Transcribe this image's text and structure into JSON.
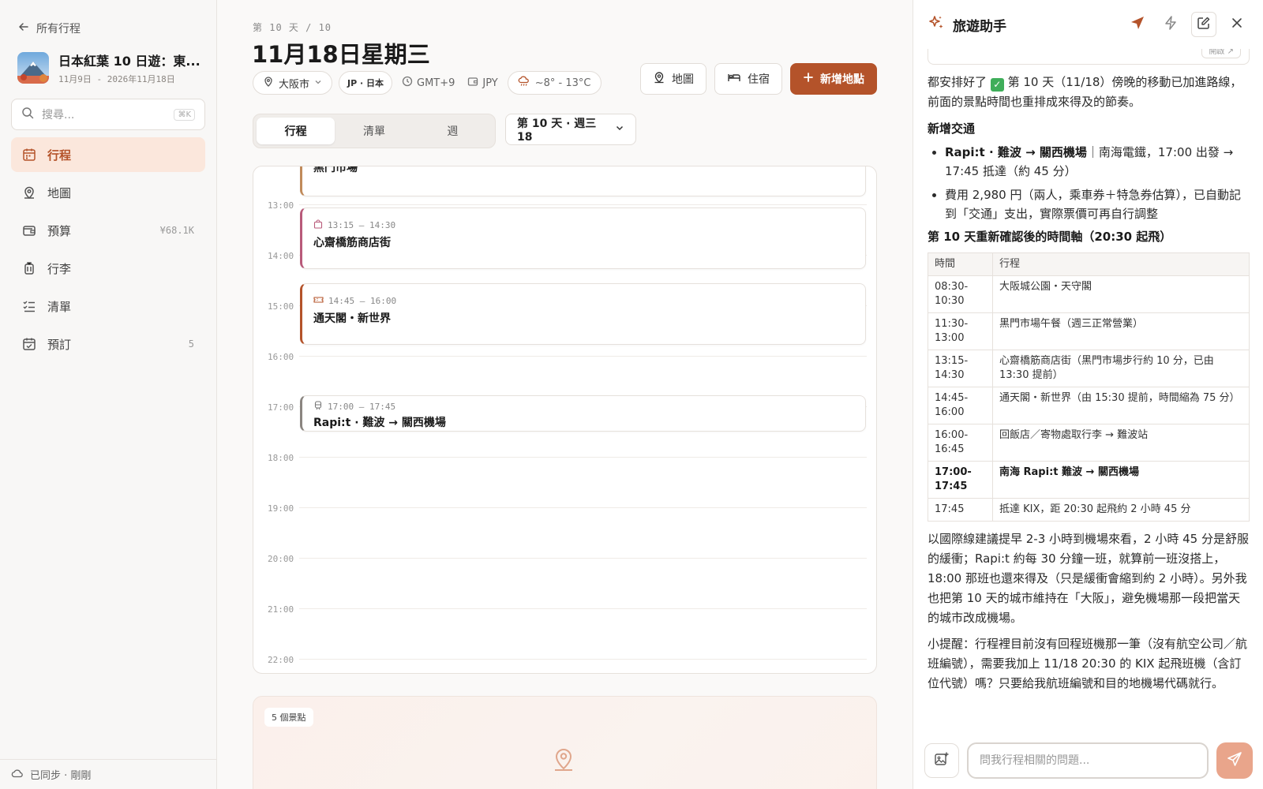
{
  "sidebar": {
    "back_label": "所有行程",
    "trip": {
      "title": "日本紅葉 10 日遊：東...",
      "dates": "11月9日 - 2026年11月18日"
    },
    "search": {
      "placeholder": "搜尋...",
      "shortcut": "⌘K"
    },
    "items": [
      {
        "label": "行程",
        "icon": "calendar-icon",
        "badge": "",
        "active": true
      },
      {
        "label": "地圖",
        "icon": "map-pin-icon",
        "badge": "",
        "active": false
      },
      {
        "label": "預算",
        "icon": "wallet-icon",
        "badge": "¥68.1K",
        "active": false
      },
      {
        "label": "行李",
        "icon": "luggage-icon",
        "badge": "",
        "active": false
      },
      {
        "label": "清單",
        "icon": "checklist-icon",
        "badge": "",
        "active": false
      },
      {
        "label": "預訂",
        "icon": "booking-calendar-icon",
        "badge": "5",
        "active": false
      }
    ],
    "sync_status": "已同步 · 剛剛"
  },
  "main": {
    "day_counter": "第 10 天 / 10",
    "day_title": "11月18日星期三",
    "meta": {
      "city": "大阪市",
      "country": "JP · 日本",
      "timezone": "GMT+9",
      "currency": "JPY",
      "weather": "~8° - 13°C"
    },
    "actions": {
      "map": "地圖",
      "lodging": "住宿",
      "add_place": "新增地點"
    },
    "view_tabs": [
      "行程",
      "清單",
      "週"
    ],
    "day_select": "第 10 天 · 週三 18",
    "hours": [
      "13:00",
      "14:00",
      "15:00",
      "16:00",
      "17:00",
      "18:00",
      "19:00",
      "20:00",
      "21:00",
      "22:00"
    ],
    "events": {
      "partial": {
        "title": "黑門市場"
      },
      "shotengai": {
        "time": "13:15 – 14:30",
        "title": "心齋橋筋商店街"
      },
      "tsutenkaku": {
        "time": "14:45 – 16:00",
        "title": "通天閣・新世界"
      },
      "rapit": {
        "time": "17:00 – 17:45",
        "title": "Rapi:t · 難波 → 關西機場"
      }
    },
    "places_badge": "5 個景點"
  },
  "assistant": {
    "title": "旅遊助手",
    "prev_chip": "開啟",
    "intro": "都安排好了 ✅ 第 10 天（11/18）傍晚的移動已加進路線，前面的景點時間也重排成來得及的節奏。",
    "intro_before": "都安排好了",
    "intro_after": "第 10 天（11/18）傍晚的移動已加進路線，前面的景點時間也重排成來得及的節奏。",
    "transport_heading": "新增交通",
    "bullet1_bold": "Rapi:t · 難波 → 關西機場",
    "bullet1_rest": "｜南海電鐵，17:00 出發 → 17:45 抵達（約 45 分）",
    "bullet2": "費用 2,980 円（兩人，乘車券＋特急券估算），已自動記到「交通」支出，實際票價可再自行調整",
    "timeline_heading": "第 10 天重新確認後的時間軸（20:30 起飛）",
    "table": {
      "headers": [
        "時間",
        "行程"
      ],
      "rows": [
        {
          "time": "08:30-10:30",
          "item": "大阪城公園・天守閣",
          "bold": false
        },
        {
          "time": "11:30-13:00",
          "item": "黑門市場午餐（週三正常營業）",
          "bold": false
        },
        {
          "time": "13:15-14:30",
          "item": "心齋橋筋商店街（黑門市場步行約 10 分，已由 13:30 提前）",
          "bold": false
        },
        {
          "time": "14:45-16:00",
          "item": "通天閣・新世界（由 15:30 提前，時間縮為 75 分）",
          "bold": false
        },
        {
          "time": "16:00-16:45",
          "item": "回飯店／寄物處取行李 → 難波站",
          "bold": false
        },
        {
          "time": "17:00-17:45",
          "item": "南海 Rapi:t 難波 → 關西機場",
          "bold": true
        },
        {
          "time": "17:45",
          "item": "抵達 KIX，距 20:30 起飛約 2 小時 45 分",
          "bold": false
        }
      ]
    },
    "para_buffer": "以國際線建議提早 2-3 小時到機場來看，2 小時 45 分是舒服的緩衝；Rapi:t 約每 30 分鐘一班，就算前一班沒搭上，18:00 那班也還來得及（只是緩衝會縮到約 2 小時）。另外我也把第 10 天的城市維持在「大阪」，避免機場那一段把當天的城市改成機場。",
    "para_tip": "小提醒：行程裡目前沒有回程班機那一筆（沒有航空公司／航班編號），需要我加上 11/18 20:30 的 KIX 起飛班機（含訂位代號）嗎？只要給我航班編號和目的地機場代碼就行。",
    "input_placeholder": "問我行程相關的問題..."
  },
  "colors": {
    "accent": "#b4532a",
    "accent_soft": "#fbe7dc",
    "send": "#e9a58b"
  }
}
